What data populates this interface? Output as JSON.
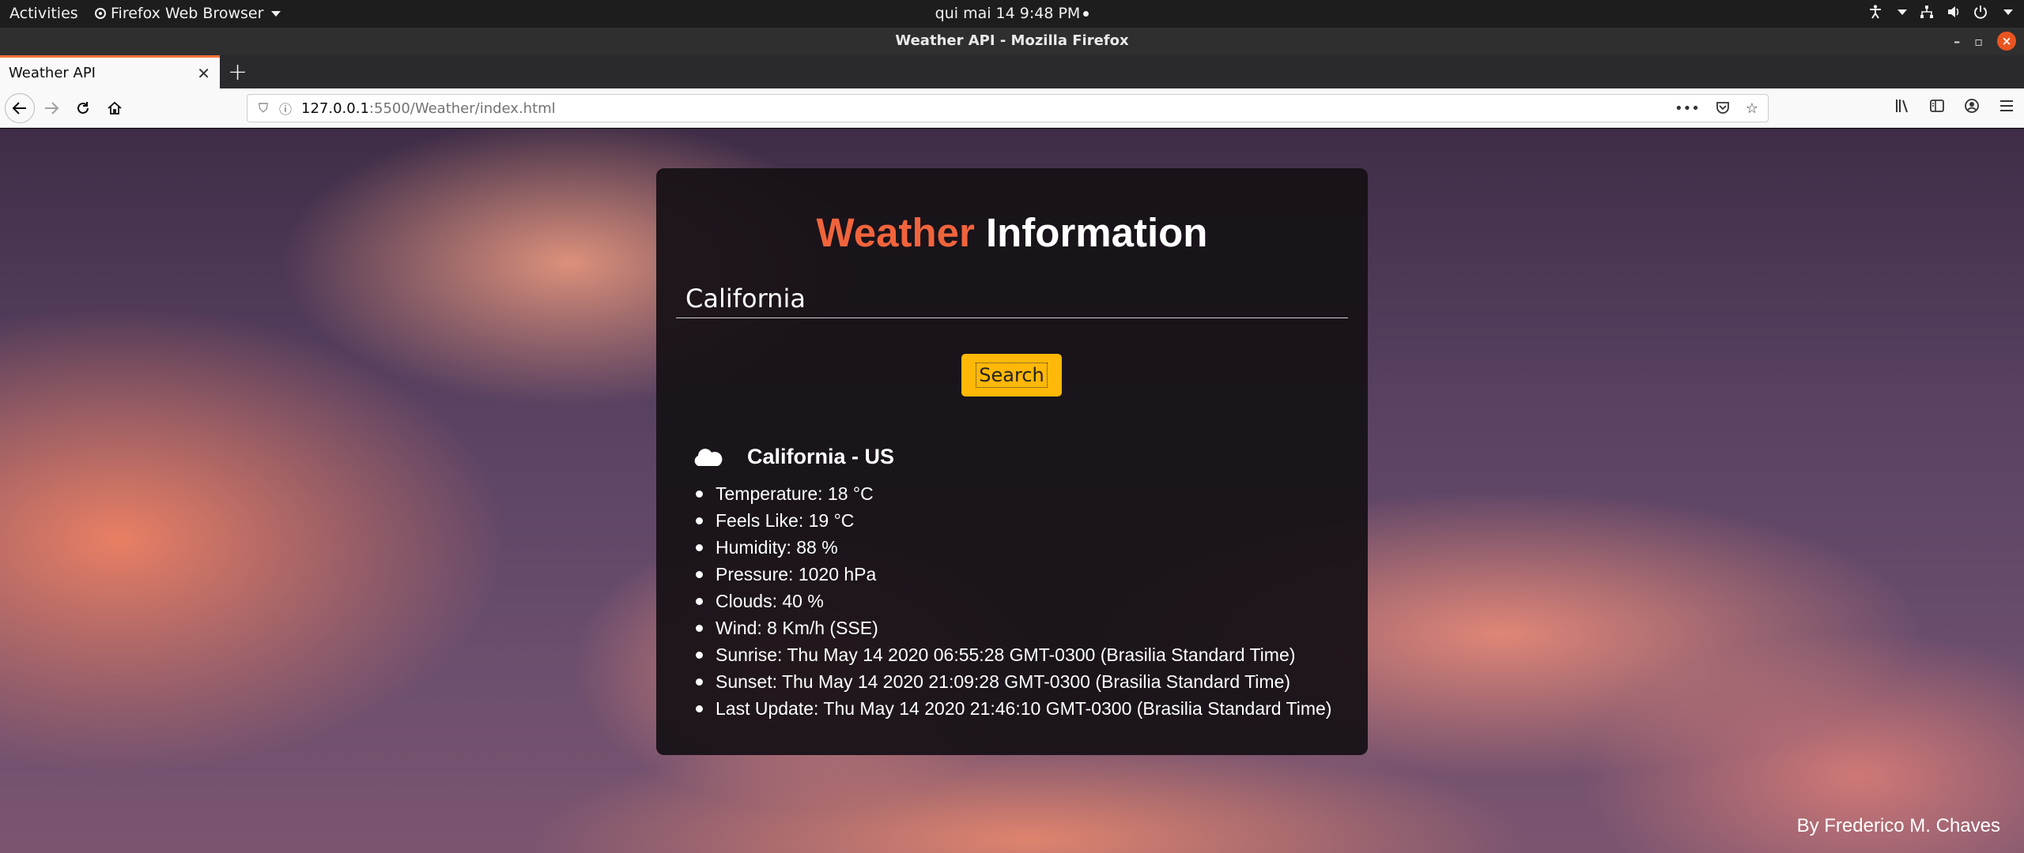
{
  "system": {
    "activities": "Activities",
    "app_name": "Firefox Web Browser",
    "clock": "qui mai 14   9:48 PM"
  },
  "window": {
    "title": "Weather API - Mozilla Firefox"
  },
  "browser": {
    "tab_title": "Weather API",
    "url_host": "127.0.0.1",
    "url_path": ":5500/Weather/index.html"
  },
  "page": {
    "heading_accent": "Weather",
    "heading_rest": " Information",
    "search_value": "California",
    "search_button": "Search",
    "result_title": "California - US",
    "details": [
      "Temperature: 18 °C",
      "Feels Like: 19 °C",
      "Humidity: 88 %",
      "Pressure: 1020 hPa",
      "Clouds: 40 %",
      "Wind: 8 Km/h (SSE)",
      "Sunrise: Thu May 14 2020 06:55:28 GMT-0300 (Brasilia Standard Time)",
      "Sunset: Thu May 14 2020 21:09:28 GMT-0300 (Brasilia Standard Time)",
      "Last Update: Thu May 14 2020 21:46:10 GMT-0300 (Brasilia Standard Time)"
    ],
    "footer": "By Frederico M. Chaves"
  },
  "colors": {
    "accent": "#f0643c",
    "button": "#ffb807",
    "tab_highlight": "#ff7139"
  }
}
